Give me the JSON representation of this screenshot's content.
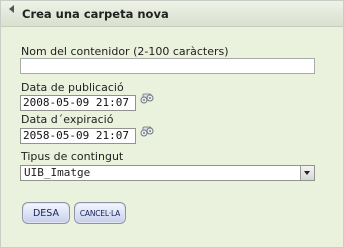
{
  "header": {
    "title": "Crea una carpeta nova",
    "collapse_icon": "triangle-left-icon"
  },
  "form": {
    "name_label": "Nom del contenidor (2-100 caràcters)",
    "name_value": "",
    "publication_label": "Data de publicació",
    "publication_value": "2008-05-09 21:07",
    "expiration_label": "Data d´expiració",
    "expiration_value": "2058-05-09 21:07",
    "calendar_icon": "calendar-picker-icon",
    "content_type_label": "Tipus de contingut",
    "content_type_value": "UIB_Imatge"
  },
  "actions": {
    "save_label": "DESA",
    "cancel_label": "CANCEL·LA"
  },
  "colors": {
    "panel_background": "#eaf1dc",
    "button_text": "#16245a"
  }
}
